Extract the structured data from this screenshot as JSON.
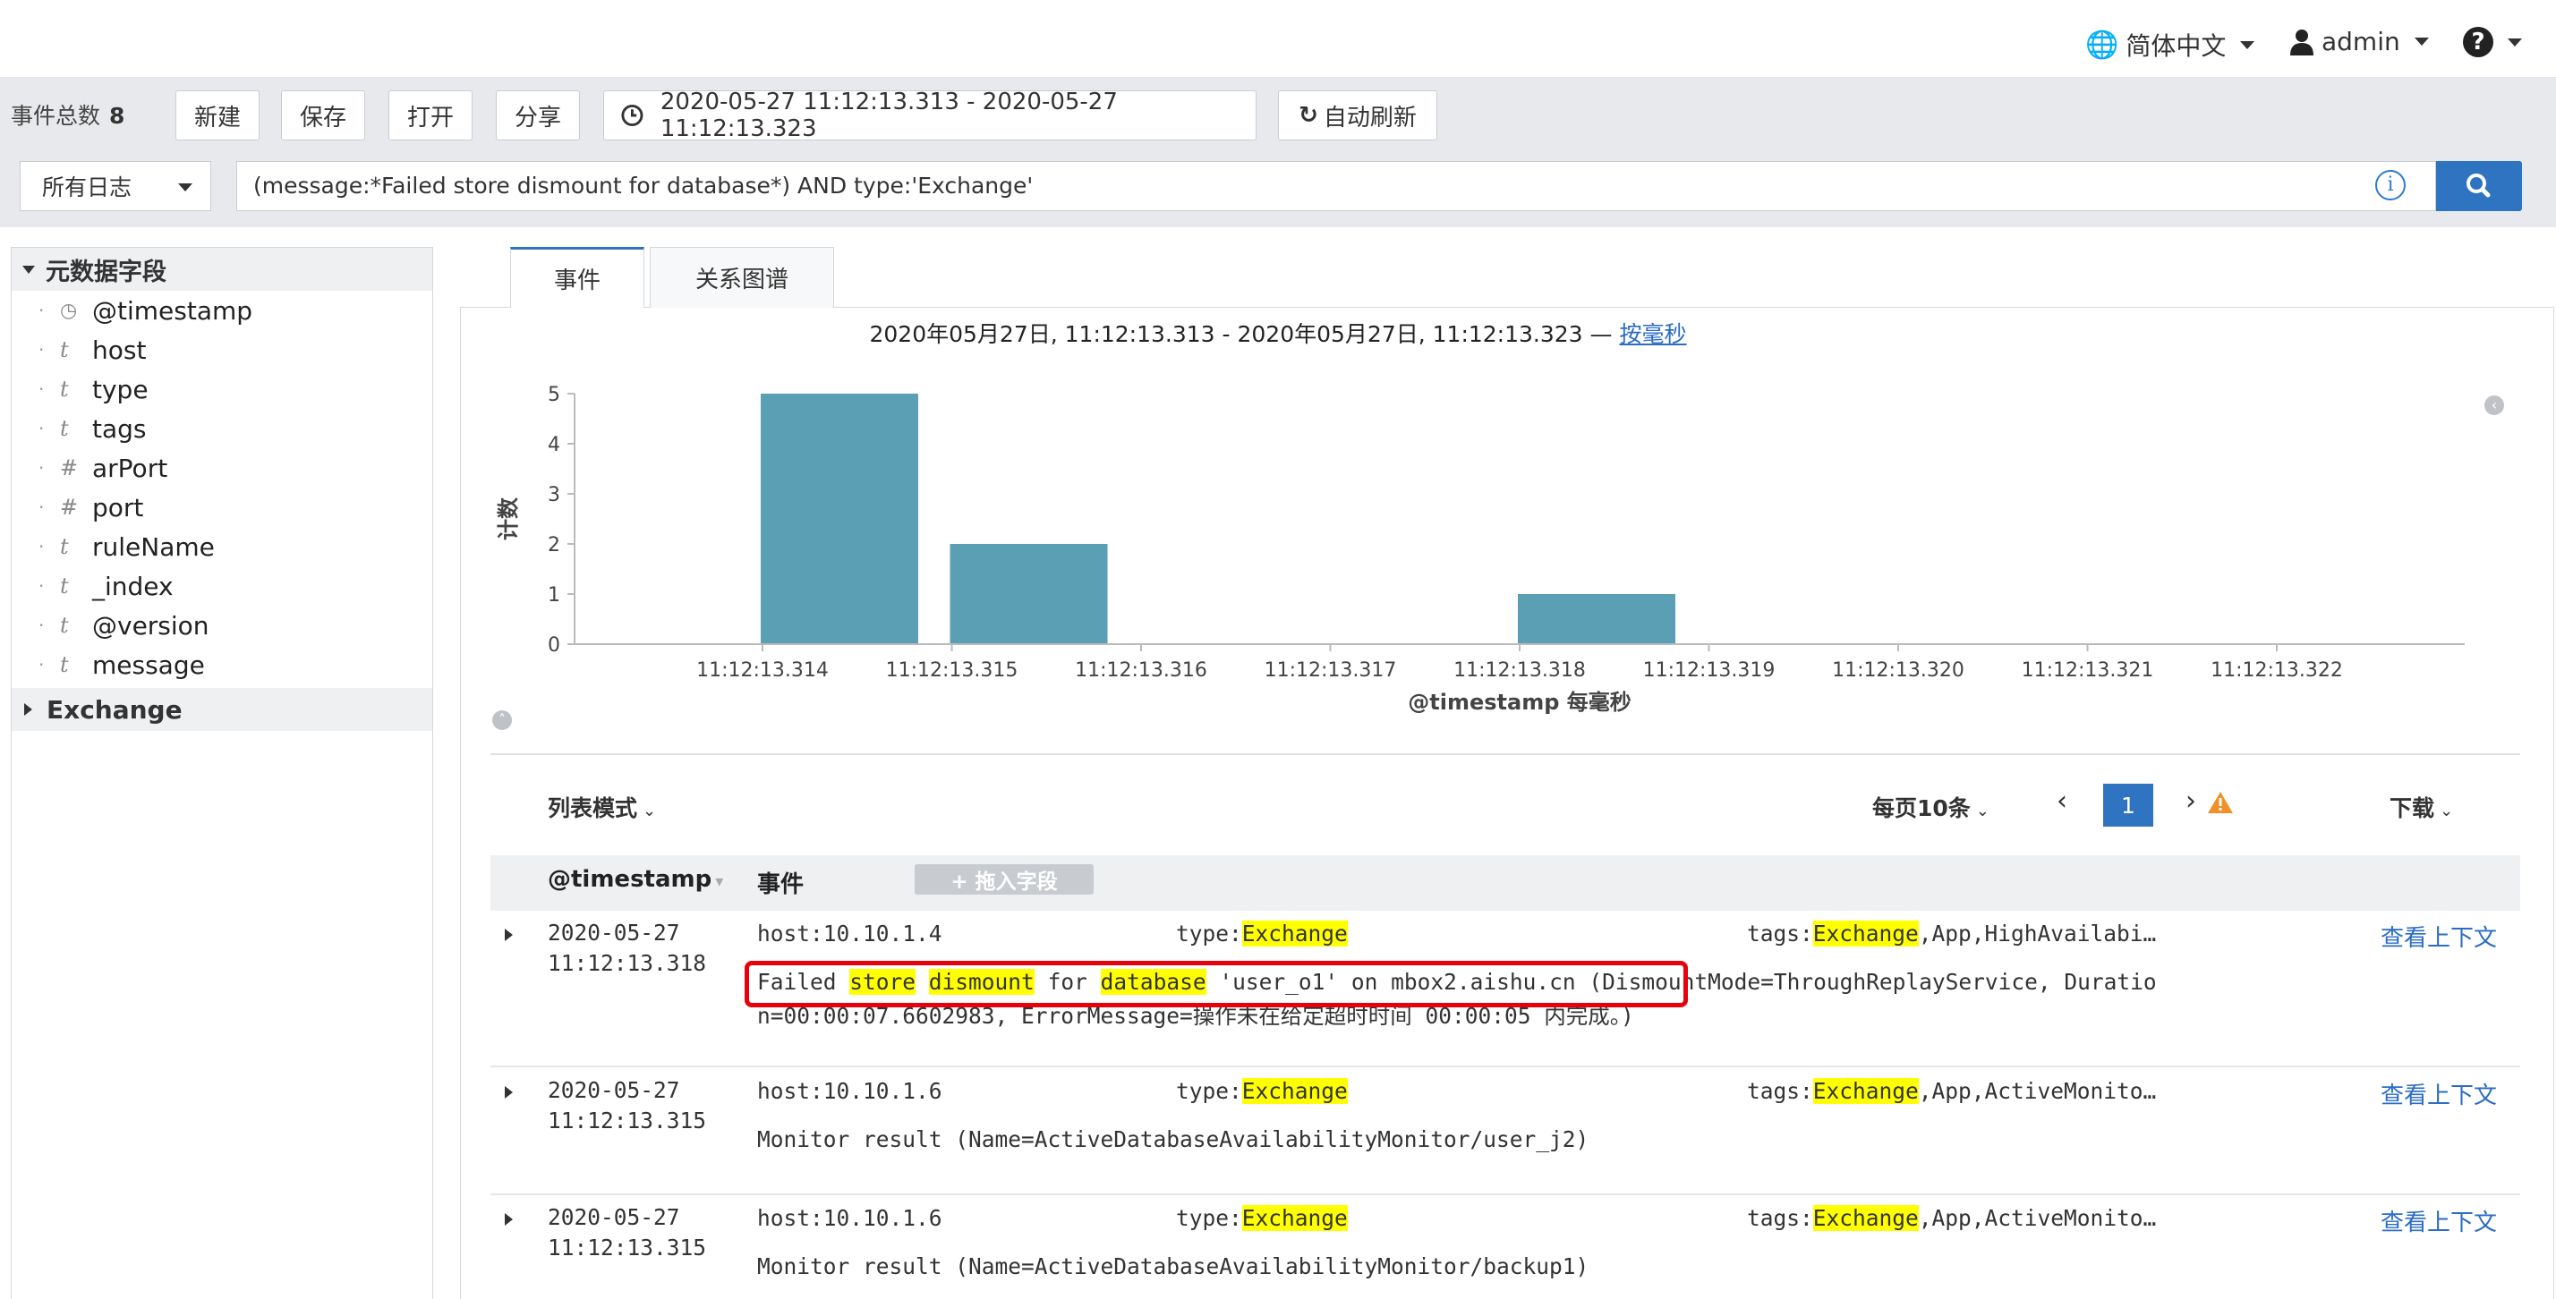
{
  "header": {
    "language": "简体中文",
    "user": "admin",
    "help": "?"
  },
  "toolbar": {
    "event_total_label": "事件总数",
    "event_total_count": "8",
    "new_label": "新建",
    "save_label": "保存",
    "open_label": "打开",
    "share_label": "分享",
    "time_range": "2020-05-27 11:12:13.313 - 2020-05-27 11:12:13.323",
    "auto_refresh_label": "自动刷新"
  },
  "search": {
    "scope": "所有日志",
    "query": "(message:*Failed store dismount for database*) AND type:'Exchange'"
  },
  "sidebar": {
    "metadata_title": "元数据字段",
    "fields": [
      {
        "name": "@timestamp",
        "type": "clock"
      },
      {
        "name": "host",
        "type": "t"
      },
      {
        "name": "type",
        "type": "t"
      },
      {
        "name": "tags",
        "type": "t"
      },
      {
        "name": "arPort",
        "type": "#"
      },
      {
        "name": "port",
        "type": "#"
      },
      {
        "name": "ruleName",
        "type": "t"
      },
      {
        "name": "_index",
        "type": "t"
      },
      {
        "name": "@version",
        "type": "t"
      },
      {
        "name": "message",
        "type": "t"
      }
    ],
    "group_title": "Exchange"
  },
  "tabs": [
    {
      "label": "事件",
      "active": true
    },
    {
      "label": "关系图谱",
      "active": false
    }
  ],
  "range_header": {
    "text": "2020年05月27日, 11:12:13.313 - 2020年05月27日, 11:12:13.323 —",
    "interval_link": "按毫秒"
  },
  "chart_data": {
    "type": "bar",
    "categories": [
      "11:12:13.314",
      "11:12:13.315",
      "11:12:13.316",
      "11:12:13.317",
      "11:12:13.318",
      "11:12:13.319",
      "11:12:13.320",
      "11:12:13.321",
      "11:12:13.322"
    ],
    "values": [
      5,
      2,
      0,
      0,
      1,
      0,
      0,
      0,
      0
    ],
    "xlabel": "@timestamp 每毫秒",
    "ylabel": "计数",
    "ylim": [
      0,
      5
    ],
    "yticks": [
      0,
      1,
      2,
      3,
      4,
      5
    ],
    "bar_color": "#5b9fb5",
    "grid": false
  },
  "list_controls": {
    "mode": "列表模式",
    "page_size": "每页10条",
    "prev": "‹",
    "page": "1",
    "next": "›",
    "download": "下载"
  },
  "table": {
    "col_timestamp": "@timestamp",
    "col_event": "事件",
    "add_field": "+ 拖入字段",
    "context_link": "查看上下文",
    "rows": [
      {
        "date": "2020-05-27",
        "time": "11:12:13.318",
        "host_key": "host:",
        "host": "10.10.1.4",
        "type_key": "type:",
        "type": "Exchange",
        "tags_key": "tags:",
        "tags_hl": "Exchange",
        "tags_rest": ",App,HighAvailabi…",
        "msg_parts": [
          "Failed ",
          "store",
          " ",
          "dismount",
          " for ",
          "database",
          " 'user_o1' on mbox2.aishu.cn"
        ],
        "msg_tail": " (DismountMode=ThroughReplayService, Duratio",
        "msg_line2": "n=00:00:07.6602983, ErrorMessage=操作未在给定超时时间 00:00:05 内完成。)"
      },
      {
        "date": "2020-05-27",
        "time": "11:12:13.315",
        "host_key": "host:",
        "host": "10.10.1.6",
        "type_key": "type:",
        "type": "Exchange",
        "tags_key": "tags:",
        "tags_hl": "Exchange",
        "tags_rest": ",App,ActiveMonito…",
        "message": "Monitor result (Name=ActiveDatabaseAvailabilityMonitor/user_j2)"
      },
      {
        "date": "2020-05-27",
        "time": "11:12:13.315",
        "host_key": "host:",
        "host": "10.10.1.6",
        "type_key": "type:",
        "type": "Exchange",
        "tags_key": "tags:",
        "tags_hl": "Exchange",
        "tags_rest": ",App,ActiveMonito…",
        "message": "Monitor result (Name=ActiveDatabaseAvailabilityMonitor/backup1)"
      }
    ]
  }
}
